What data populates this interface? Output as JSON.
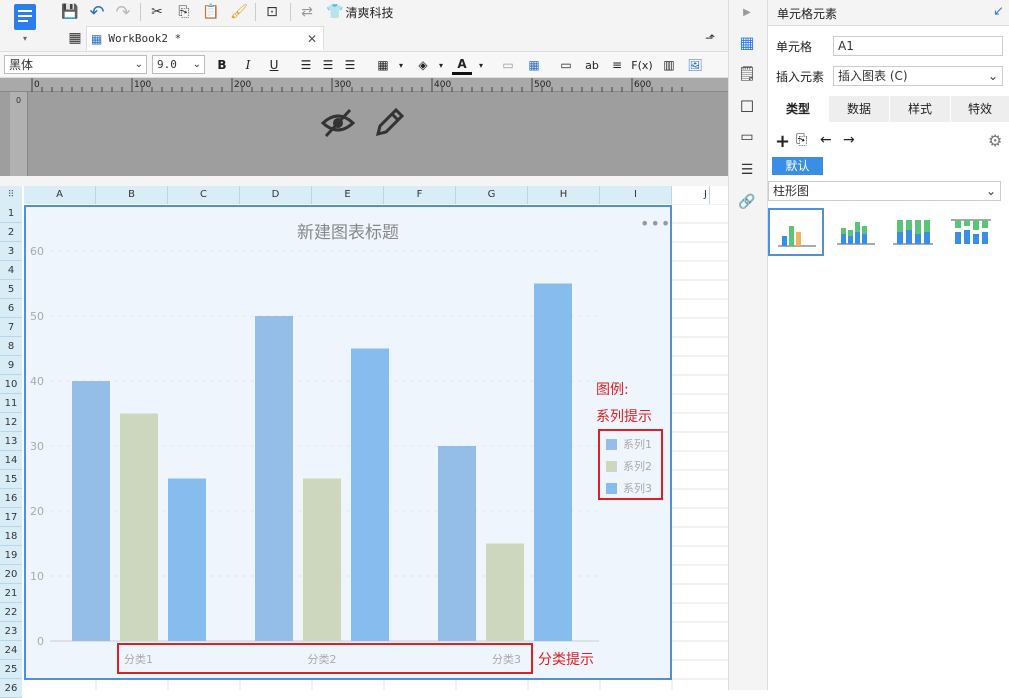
{
  "toolbar": {
    "brand_label": "清爽科技",
    "tab_label": "WorkBook2 *",
    "font_name": "黑体",
    "font_size": "9.0"
  },
  "ruler": {
    "ticks": [
      "0",
      "100",
      "200",
      "300",
      "400",
      "500",
      "600"
    ]
  },
  "grid": {
    "columns": [
      "A",
      "B",
      "C",
      "D",
      "E",
      "F",
      "G",
      "H",
      "I",
      "J"
    ],
    "rows": [
      "1",
      "2",
      "3",
      "4",
      "5",
      "6",
      "7",
      "8",
      "9",
      "10",
      "11",
      "12",
      "13",
      "14",
      "15",
      "16",
      "17",
      "18",
      "19",
      "20",
      "21",
      "22",
      "23",
      "24",
      "25",
      "26"
    ]
  },
  "chart_data": {
    "type": "bar",
    "title": "新建图表标题",
    "categories": [
      "分类1",
      "分类2",
      "分类3"
    ],
    "series": [
      {
        "name": "系列1",
        "values": [
          40,
          50,
          30
        ],
        "color": "#94bde8"
      },
      {
        "name": "系列2",
        "values": [
          35,
          25,
          15
        ],
        "color": "#cdd7be"
      },
      {
        "name": "系列3",
        "values": [
          25,
          45,
          55
        ],
        "color": "#86bdee"
      }
    ],
    "yticks": [
      "0",
      "10",
      "20",
      "30",
      "40",
      "50",
      "60"
    ],
    "ylim": [
      0,
      60
    ],
    "legend_position": "right",
    "grid": true
  },
  "annotations": {
    "legend_note_1": "图例:",
    "legend_note_2": "系列提示",
    "category_note": "分类提示"
  },
  "panel": {
    "title": "单元格元素",
    "cell_label": "单元格",
    "cell_value": "A1",
    "insert_label": "插入元素",
    "insert_value": "插入图表 (C)",
    "tabs": [
      "类型",
      "数据",
      "样式",
      "特效"
    ],
    "default_label": "默认",
    "chart_type": "柱形图"
  },
  "colors": {
    "accent": "#2b7de9",
    "annotation_red": "#e02020",
    "header_bg": "#d9edf7"
  }
}
